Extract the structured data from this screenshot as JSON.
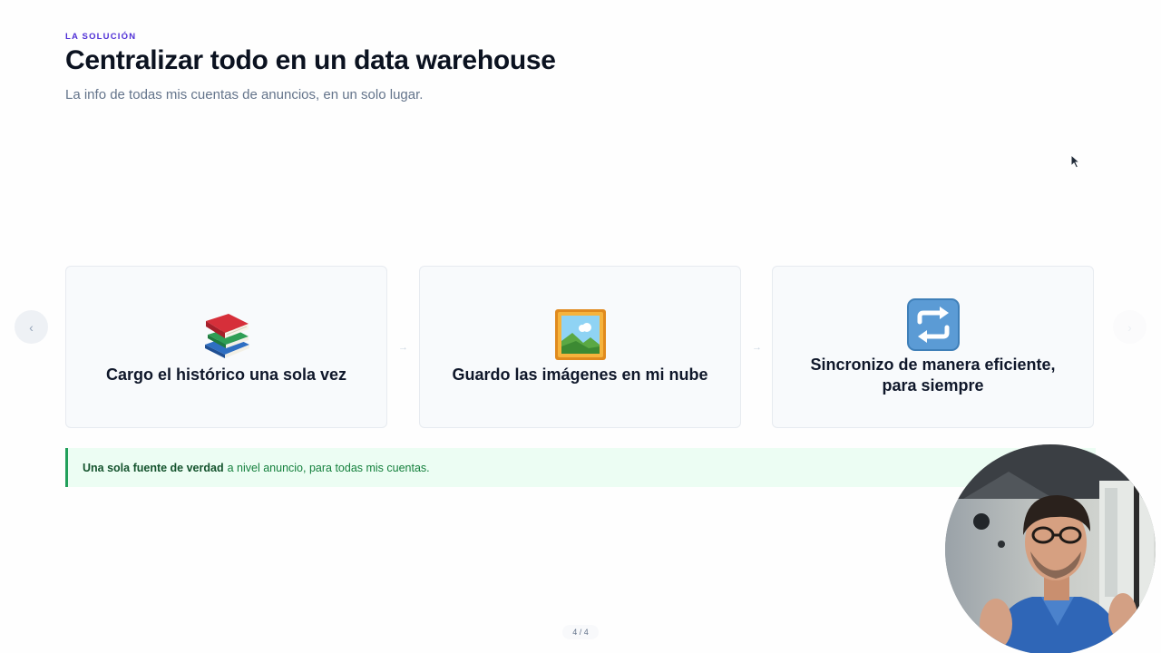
{
  "header": {
    "eyebrow": "LA SOLUCIÓN",
    "title": "Centralizar todo en un data warehouse",
    "subtitle": "La info de todas mis cuentas de anuncios, en un solo lugar."
  },
  "steps": [
    {
      "icon": "books-icon",
      "label": "Cargo el histórico una sola vez"
    },
    {
      "icon": "framed-picture-icon",
      "label": "Guardo las imágenes en mi nube"
    },
    {
      "icon": "sync-arrows-icon",
      "label": "Sincronizo de manera eficiente, para siempre"
    }
  ],
  "arrows": [
    "→",
    "→"
  ],
  "navigation": {
    "prev_label": "‹",
    "next_label": "›"
  },
  "callout": {
    "bold": "Una sola fuente de verdad",
    "text": "a nivel anuncio, para todas mis cuentas."
  },
  "pager": "4 / 4",
  "colors": {
    "accent": "#4f2fd6",
    "success": "#22a05b",
    "callout_bg": "#ecfdf3"
  }
}
